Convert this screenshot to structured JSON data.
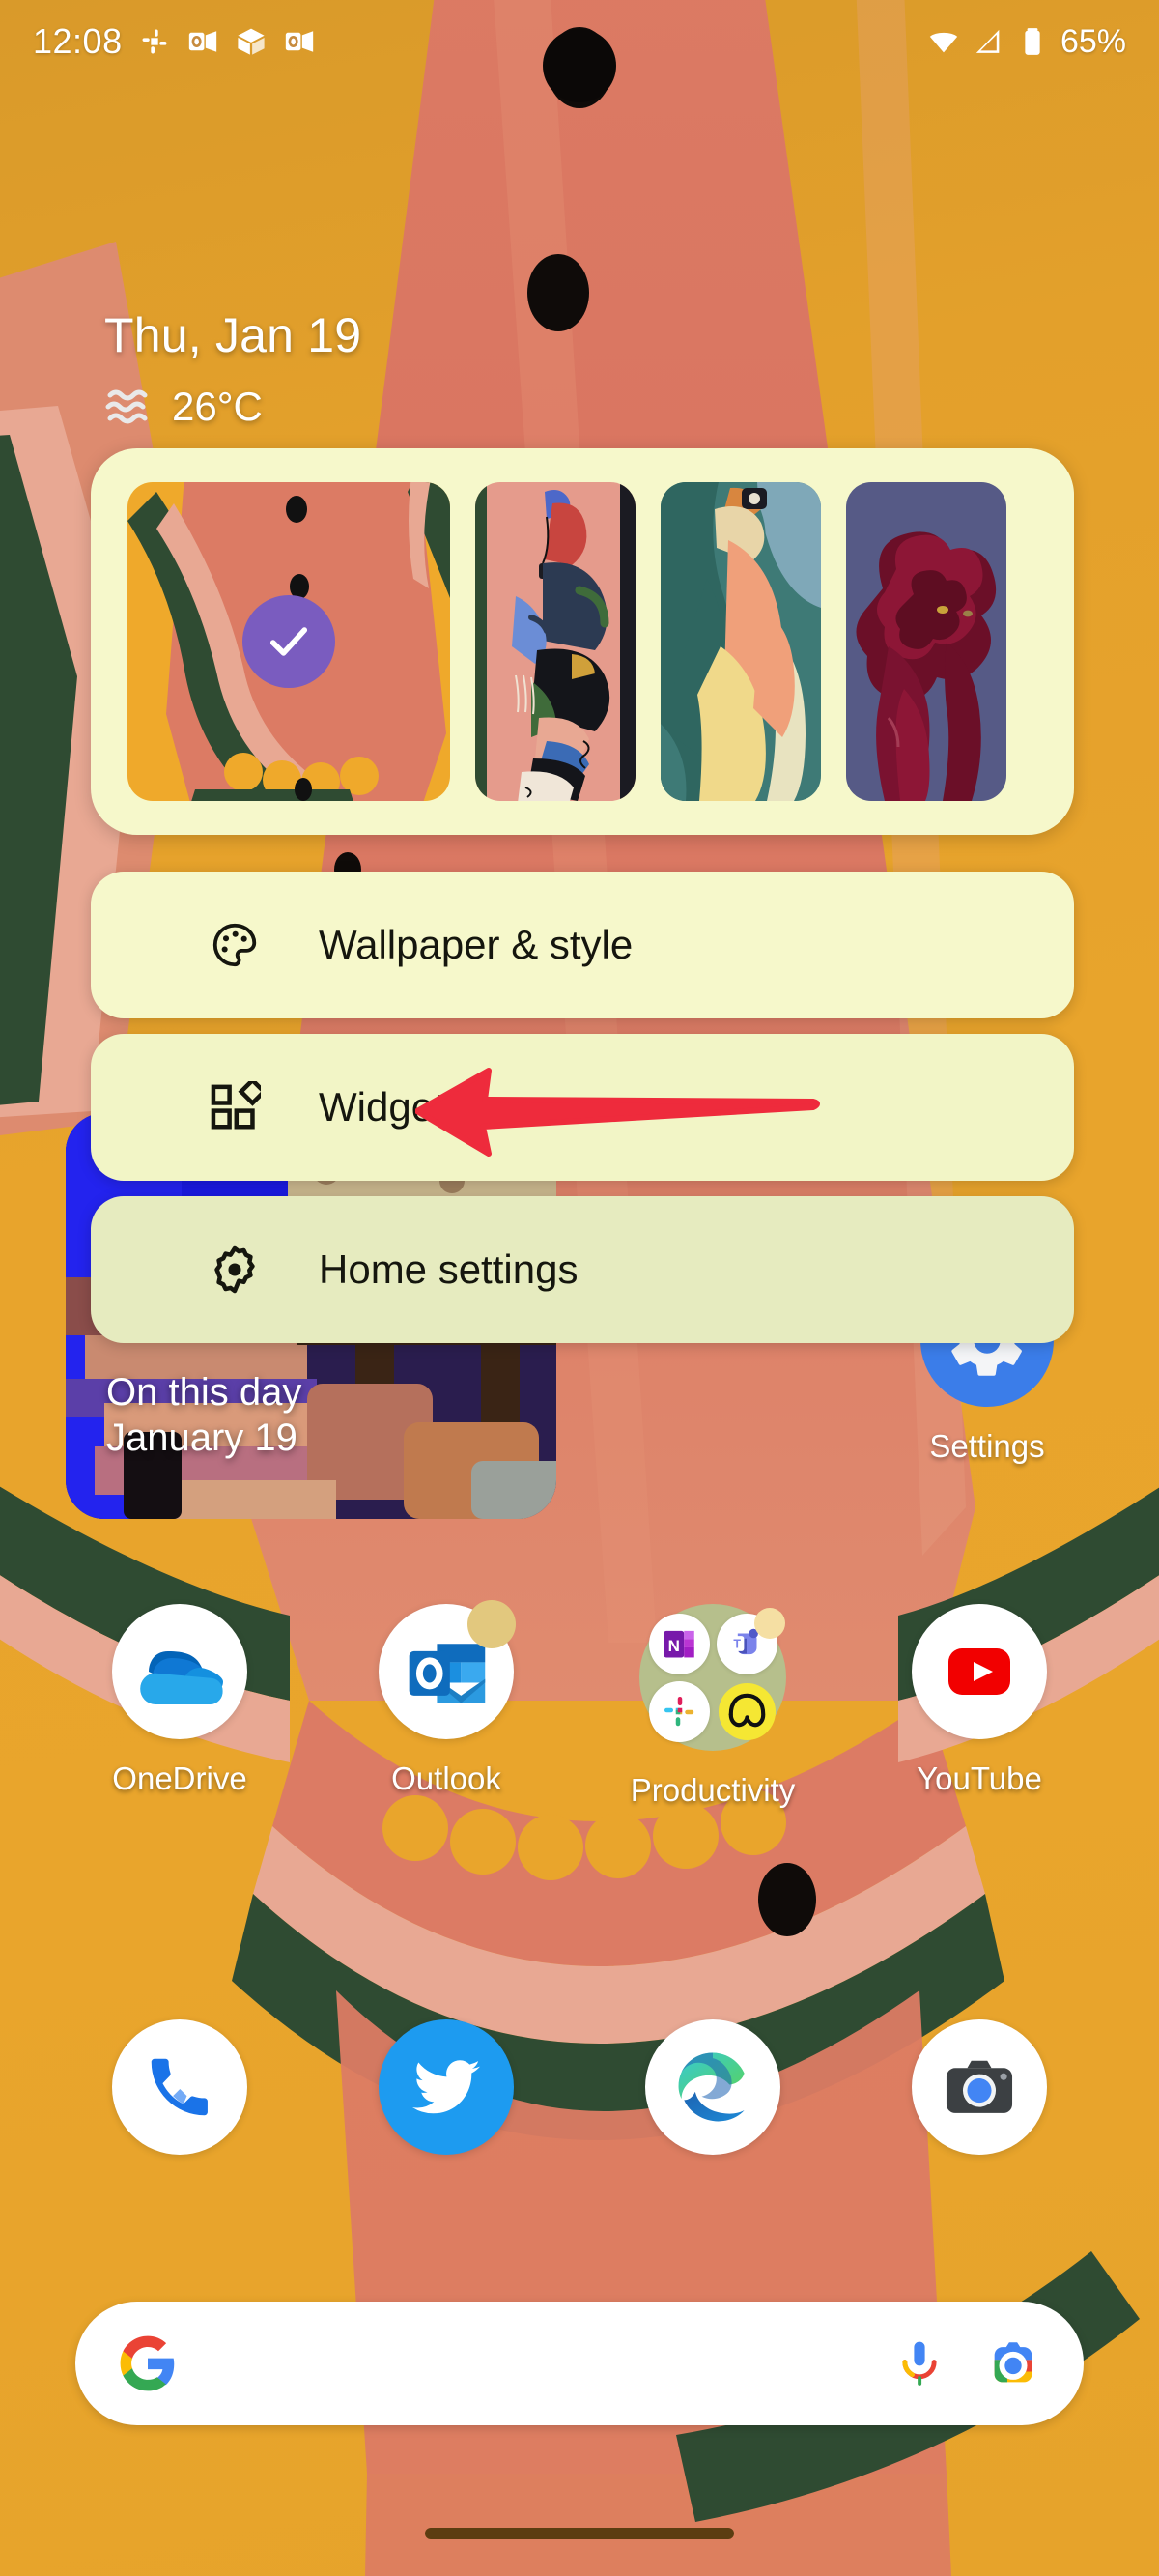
{
  "status_bar": {
    "time": "12:08",
    "battery_percent": "65%",
    "notification_icons": [
      "slack-icon",
      "outlook-icon",
      "box-3d-icon",
      "outlook-icon"
    ],
    "system_icons": [
      "wifi-icon",
      "cellular-signal-icon",
      "battery-icon"
    ]
  },
  "glance_widget": {
    "date": "Thu, Jan 19",
    "temperature": "26°C",
    "weather_icon": "haze-waves-icon"
  },
  "photo_widget": {
    "title": "On this day",
    "subtitle": "January 19"
  },
  "settings_shortcut": {
    "label": "Settings",
    "icon": "gear-icon",
    "color": "#3b7de9"
  },
  "app_row": [
    {
      "label": "OneDrive",
      "icon": "onedrive-icon",
      "badge": false
    },
    {
      "label": "Outlook",
      "icon": "outlook-icon",
      "badge": true
    },
    {
      "label": "Productivity",
      "icon": "folder-icon",
      "badge": false,
      "folder_apps": [
        "onenote-icon",
        "teams-icon",
        "slack-icon",
        "basecamp-icon"
      ]
    },
    {
      "label": "YouTube",
      "icon": "youtube-icon",
      "badge": false
    }
  ],
  "dock": [
    {
      "label": "Phone",
      "icon": "phone-icon"
    },
    {
      "label": "Twitter",
      "icon": "twitter-icon"
    },
    {
      "label": "Edge",
      "icon": "edge-icon"
    },
    {
      "label": "Camera",
      "icon": "camera-icon"
    }
  ],
  "search": {
    "placeholder": "",
    "value": "",
    "logo_icon": "google-g-icon",
    "mic_icon": "microphone-icon",
    "lens_icon": "google-lens-icon"
  },
  "popup_menu": {
    "wallpaper_thumbnails": [
      {
        "name": "watermelon-wallpaper",
        "selected": true,
        "check_icon": "check-icon"
      },
      {
        "name": "skater-wallpaper",
        "selected": false
      },
      {
        "name": "bird-wallpaper",
        "selected": false
      },
      {
        "name": "rose-wallpaper",
        "selected": false
      }
    ],
    "items": [
      {
        "label": "Wallpaper & style",
        "icon": "palette-icon",
        "highlighted": false
      },
      {
        "label": "Widgets",
        "icon": "widgets-icon",
        "highlighted": true
      },
      {
        "label": "Home settings",
        "icon": "gear-icon",
        "highlighted": false
      }
    ],
    "card_color": "#f6f8cb"
  },
  "annotation": {
    "type": "arrow",
    "points_to": "Widgets",
    "direction": "left",
    "color": "#ee2b3c"
  },
  "nav_pill": {
    "color": "#5c3d11"
  }
}
